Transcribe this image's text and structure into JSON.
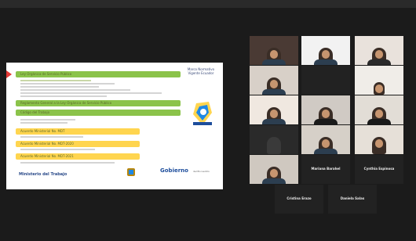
{
  "slide": {
    "title_line1": "Marco Normativo",
    "title_line2": "Vigente Ecuador",
    "rows": [
      {
        "type": "green",
        "text": "Ley Orgánica de Servicio Público"
      },
      {
        "type": "green",
        "text": "Reglamento General a la Ley Orgánica de Servicio Público"
      },
      {
        "type": "green",
        "text": "Código del Trabajo"
      },
      {
        "type": "yellow",
        "text": "Acuerdo Ministerial No. MDT"
      },
      {
        "type": "yellow",
        "text": "Acuerdo Ministerial No. MDT-2020"
      },
      {
        "type": "yellow",
        "text": "Acuerdo Ministerial No. MDT-2021"
      }
    ],
    "footer_left": "Ministerio del Trabajo",
    "footer_right": "Gobierno",
    "footer_right_sub": "del Encuentro"
  },
  "participants": [
    {
      "name": "",
      "kind": "video"
    },
    {
      "name": "",
      "kind": "video"
    },
    {
      "name": "",
      "kind": "video"
    },
    {
      "name": "",
      "kind": "video"
    },
    {
      "name": "",
      "kind": "video"
    },
    {
      "name": "",
      "kind": "video"
    },
    {
      "name": "",
      "kind": "video"
    },
    {
      "name": "",
      "kind": "video"
    },
    {
      "name": "",
      "kind": "video"
    },
    {
      "name": "",
      "kind": "video"
    },
    {
      "name": "",
      "kind": "video"
    },
    {
      "name": "",
      "kind": "video"
    },
    {
      "name": "",
      "kind": "video"
    },
    {
      "name": "",
      "kind": "video"
    },
    {
      "name": "Mariana Barahel",
      "kind": "avatar"
    },
    {
      "name": "Cynthia Espinosa",
      "kind": "avatar"
    },
    {
      "name": "Cristina Erazo",
      "kind": "avatar"
    },
    {
      "name": "Daniela Salas",
      "kind": "avatar"
    }
  ],
  "colors": {
    "green": "#8bc34a",
    "yellow": "#ffd54f",
    "background": "#1b1b1b"
  }
}
